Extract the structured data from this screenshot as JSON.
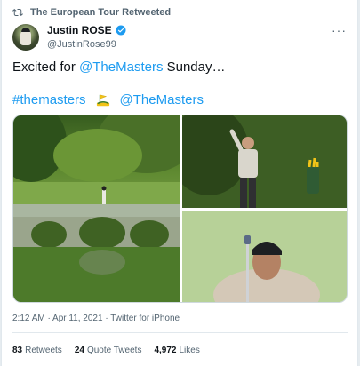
{
  "retweet_header": {
    "label": "The European Tour Retweeted",
    "icon": "retweet-icon"
  },
  "author": {
    "name": "Justin ROSE",
    "handle": "@JustinRose99",
    "verified_icon": "verified-badge-icon",
    "avatar_icon": "avatar"
  },
  "more_icon": "more-options-icon",
  "tweet": {
    "text_prefix": "Excited for ",
    "mention": "@TheMasters",
    "text_suffix": " Sunday…",
    "hashtag": "#themasters",
    "hashtag_emoji_icon": "masters-flag-emoji-icon",
    "mention_2": "@TheMasters"
  },
  "media": {
    "photos": [
      {
        "name": "photo-augusta-bridge"
      },
      {
        "name": "photo-rose-waving"
      },
      {
        "name": "photo-rose-putting-read"
      }
    ]
  },
  "meta": {
    "timestamp": "2:12 AM · Apr 11, 2021 · Twitter for iPhone"
  },
  "stats": {
    "retweets_count": "83",
    "retweets_label": "Retweets",
    "quotes_count": "24",
    "quotes_label": "Quote Tweets",
    "likes_count": "4,972",
    "likes_label": "Likes"
  },
  "colors": {
    "link": "#1d9bf0",
    "secondary_text": "#536471",
    "primary_text": "#0f1419"
  }
}
